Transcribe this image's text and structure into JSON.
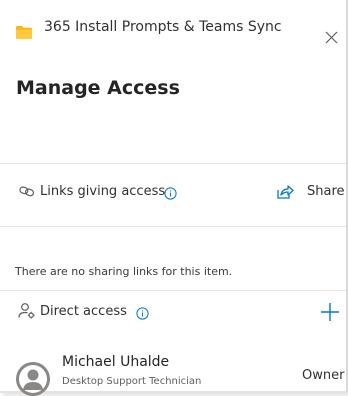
{
  "header": {
    "title": "365 Install Prompts & Teams Sync",
    "folder_icon": "folder-icon",
    "close_icon": "close-icon"
  },
  "page_title": "Manage Access",
  "links_section": {
    "label": "Links giving access",
    "icon": "link-icon",
    "info_icon": "info-icon",
    "share_label": "Share",
    "share_icon": "share-icon",
    "empty_message": "There are no sharing links for this item."
  },
  "direct_section": {
    "label": "Direct access",
    "icon": "people-settings-icon",
    "info_icon": "info-icon",
    "add_icon": "plus-icon"
  },
  "people": [
    {
      "name": "Michael Uhalde",
      "role": "Desktop Support Technician",
      "permission": "Owner"
    }
  ],
  "colors": {
    "accent": "#0078d4",
    "folder": "#ffb900",
    "text": "#323130",
    "divider": "#e8e6e5"
  }
}
